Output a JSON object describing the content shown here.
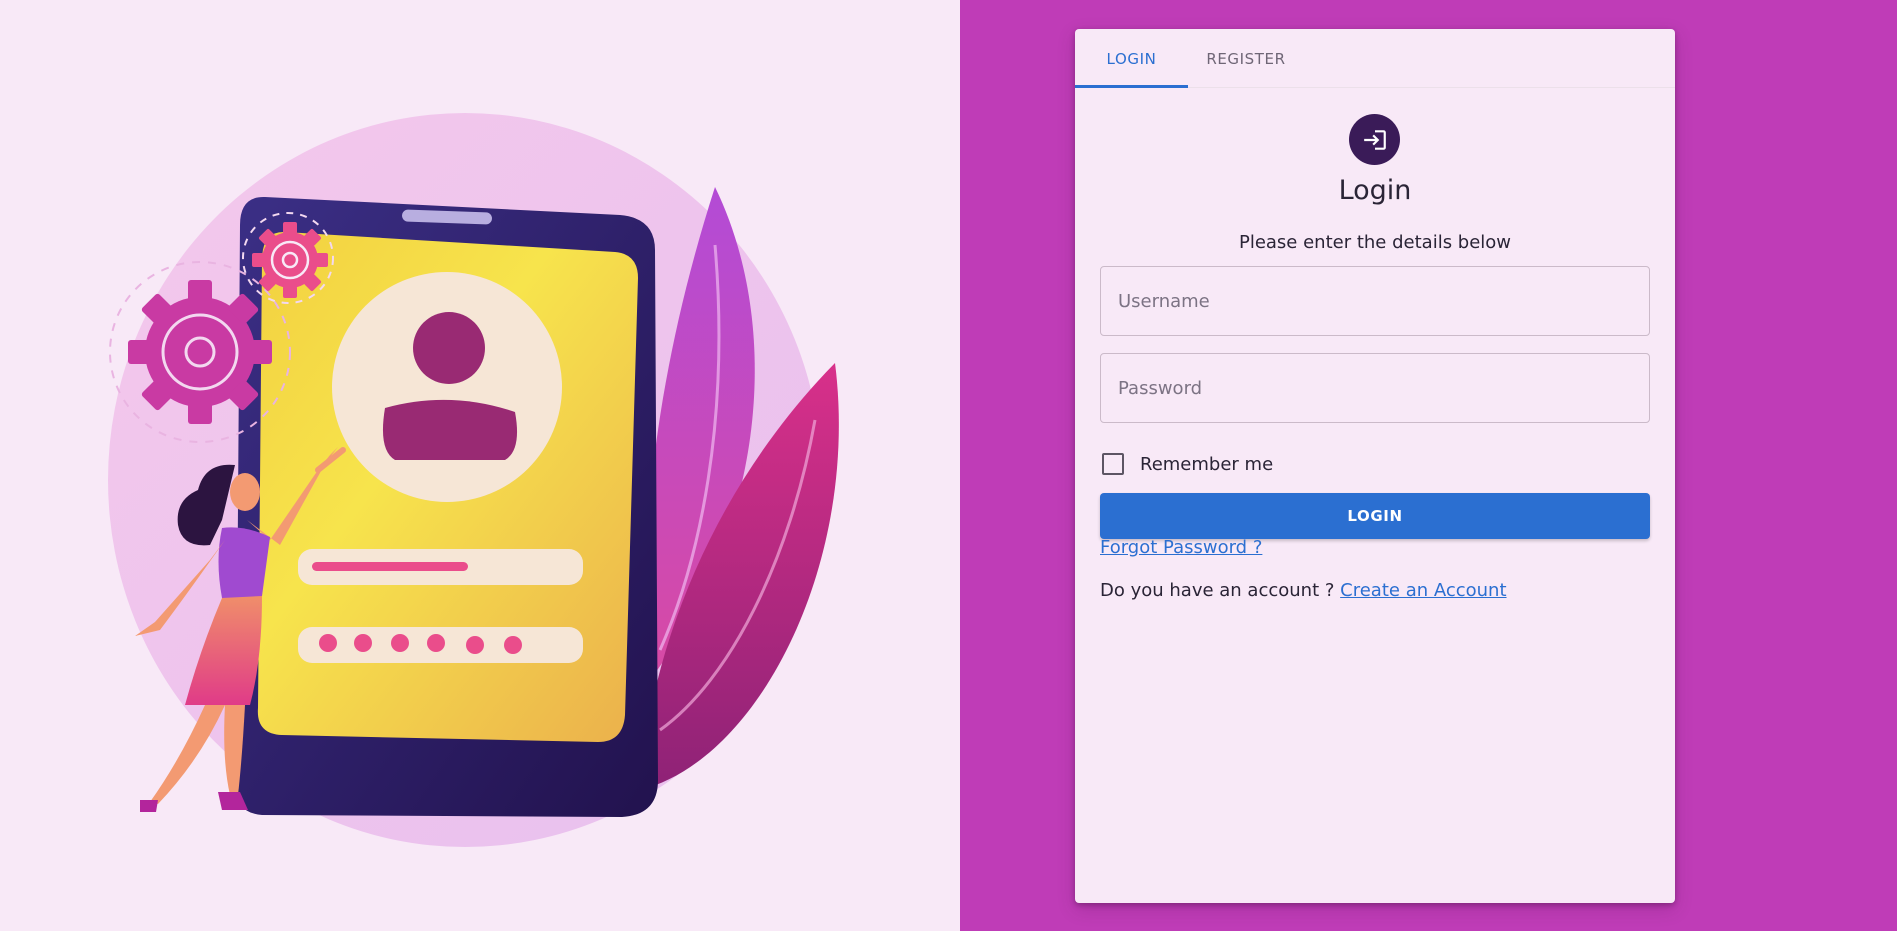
{
  "tabs": [
    {
      "label": "LOGIN",
      "active": true
    },
    {
      "label": "REGISTER",
      "active": false
    }
  ],
  "header": {
    "icon": "login-icon",
    "title": "Login",
    "subtitle": "Please enter the details below"
  },
  "form": {
    "username_placeholder": "Username",
    "password_placeholder": "Password",
    "remember_label": "Remember me",
    "remember_checked": false,
    "submit_label": "LOGIN",
    "forgot_label": "Forgot Password ?",
    "account_prompt": "Do you have an account ?",
    "create_account_label": "Create an Account"
  },
  "colors": {
    "page_background": "#f8e9f7",
    "right_panel": "#bf3cb7",
    "accent": "#2b6fd1",
    "avatar_bg": "#3a1b58"
  },
  "illustration": {
    "icon": "phone-login-illustration"
  }
}
